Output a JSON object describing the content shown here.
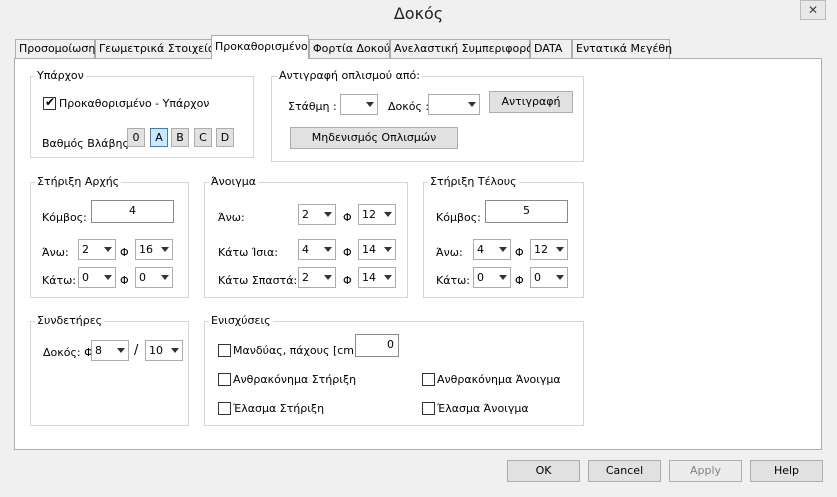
{
  "window": {
    "title": "Δοκός",
    "close_glyph": "✕"
  },
  "tabs": [
    {
      "label": "Προσομοίωση"
    },
    {
      "label": "Γεωμετρικά Στοιχεία"
    },
    {
      "label": "Προκαθορισμένο"
    },
    {
      "label": "Φορτία Δοκού"
    },
    {
      "label": "Ανελαστική Συμπεριφορά"
    },
    {
      "label": "DATA"
    },
    {
      "label": "Εντατικά Μεγέθη"
    }
  ],
  "existing": {
    "legend": "Υπάρχον",
    "checkbox_label": "Προκαθορισμένο - Υπάρχον",
    "checkbox_checked": true,
    "damage_label": "Βαθμός Βλάβης",
    "damage_buttons": [
      "0",
      "A",
      "B",
      "C",
      "D"
    ],
    "damage_selected": "A"
  },
  "copy": {
    "legend": "Αντιγραφή οπλισμού από:",
    "level_label": "Στάθμη :",
    "level_value": "",
    "beam_label": "Δοκός :",
    "beam_value": "",
    "copy_button": "Αντιγραφή",
    "zero_button": "Μηδενισμός Οπλισμών"
  },
  "start_support": {
    "legend": "Στήριξη Αρχής",
    "node_label": "Κόμβος:",
    "node_value": "4",
    "top_label": "Άνω:",
    "top_count": "2",
    "top_dia": "16",
    "bottom_label": "Κάτω:",
    "bottom_count": "0",
    "bottom_dia": "0",
    "phi": "Φ"
  },
  "span": {
    "legend": "Άνοιγμα",
    "top_label": "Άνω:",
    "top_count": "2",
    "top_dia": "12",
    "straight_label": "Κάτω Ίσια:",
    "straight_count": "4",
    "straight_dia": "14",
    "bent_label": "Κάτω Σπαστά:",
    "bent_count": "2",
    "bent_dia": "14",
    "phi": "Φ"
  },
  "end_support": {
    "legend": "Στήριξη Τέλους",
    "node_label": "Κόμβος:",
    "node_value": "5",
    "top_label": "Άνω:",
    "top_count": "4",
    "top_dia": "12",
    "bottom_label": "Κάτω:",
    "bottom_count": "0",
    "bottom_dia": "0",
    "phi": "Φ"
  },
  "stirrups": {
    "legend": "Συνδετήρες",
    "label": "Δοκός: Φ",
    "dia": "8",
    "sep": "/",
    "spacing": "10"
  },
  "reinforcements": {
    "legend": "Ενισχύσεις",
    "jacket_label": "Μανδύας, πάχους [cm]",
    "jacket_value": "0",
    "cfrp_support": "Ανθρακόνημα Στήριξη",
    "cfrp_span": "Ανθρακόνημα Άνοιγμα",
    "plate_support": "Έλασμα Στήριξη",
    "plate_span": "Έλασμα Άνοιγμα"
  },
  "buttons": {
    "ok": "OK",
    "cancel": "Cancel",
    "apply": "Apply",
    "help": "Help"
  },
  "colors": {
    "selected_damage_bg": "#cce8ff",
    "selected_damage_border": "#3c7fb1",
    "disabled_text": "#838383"
  }
}
